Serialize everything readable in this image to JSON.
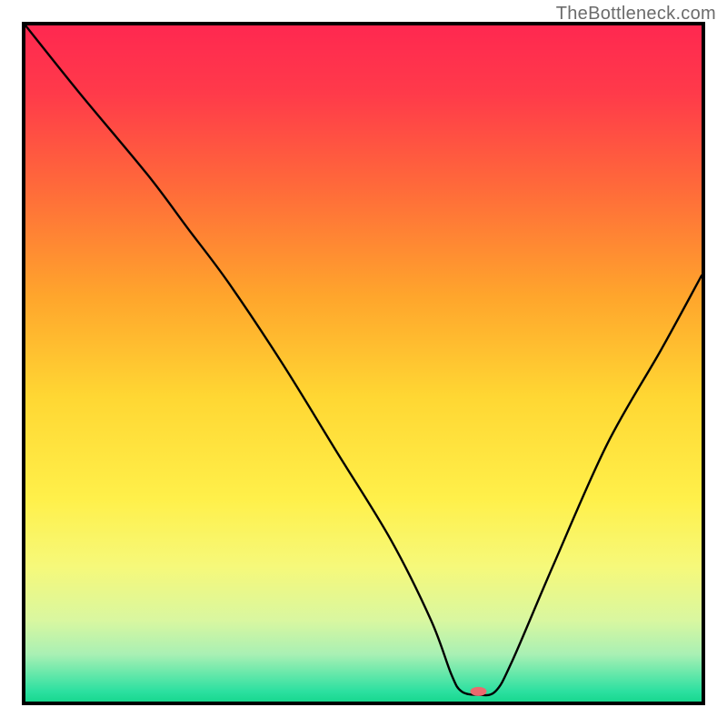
{
  "attribution": "TheBottleneck.com",
  "chart_data": {
    "type": "line",
    "title": "",
    "xlabel": "",
    "ylabel": "",
    "xlim": [
      0,
      100
    ],
    "ylim": [
      0,
      100
    ],
    "series": [
      {
        "name": "curve",
        "x": [
          0,
          8,
          18,
          24,
          30,
          38,
          46,
          54,
          60,
          63,
          64.5,
          67,
          69.5,
          72,
          78,
          86,
          94,
          100
        ],
        "y": [
          100,
          90,
          78,
          70,
          62,
          50,
          37,
          24,
          12,
          4,
          1.5,
          1,
          1.5,
          6,
          20,
          38,
          52,
          63
        ]
      }
    ],
    "marker": {
      "x": 67,
      "y": 1.5,
      "color": "#ea6a6e",
      "rx": 9,
      "ry": 5
    },
    "gradient_stops": [
      {
        "offset": 0.0,
        "color": "#ff2850"
      },
      {
        "offset": 0.1,
        "color": "#ff3a4a"
      },
      {
        "offset": 0.24,
        "color": "#ff6a3a"
      },
      {
        "offset": 0.4,
        "color": "#ffa52c"
      },
      {
        "offset": 0.55,
        "color": "#ffd733"
      },
      {
        "offset": 0.7,
        "color": "#fff04a"
      },
      {
        "offset": 0.8,
        "color": "#f6f97a"
      },
      {
        "offset": 0.88,
        "color": "#d9f7a0"
      },
      {
        "offset": 0.93,
        "color": "#a9f0b4"
      },
      {
        "offset": 0.965,
        "color": "#58e6a8"
      },
      {
        "offset": 0.985,
        "color": "#2ce0a0"
      },
      {
        "offset": 1.0,
        "color": "#18d88f"
      }
    ]
  }
}
